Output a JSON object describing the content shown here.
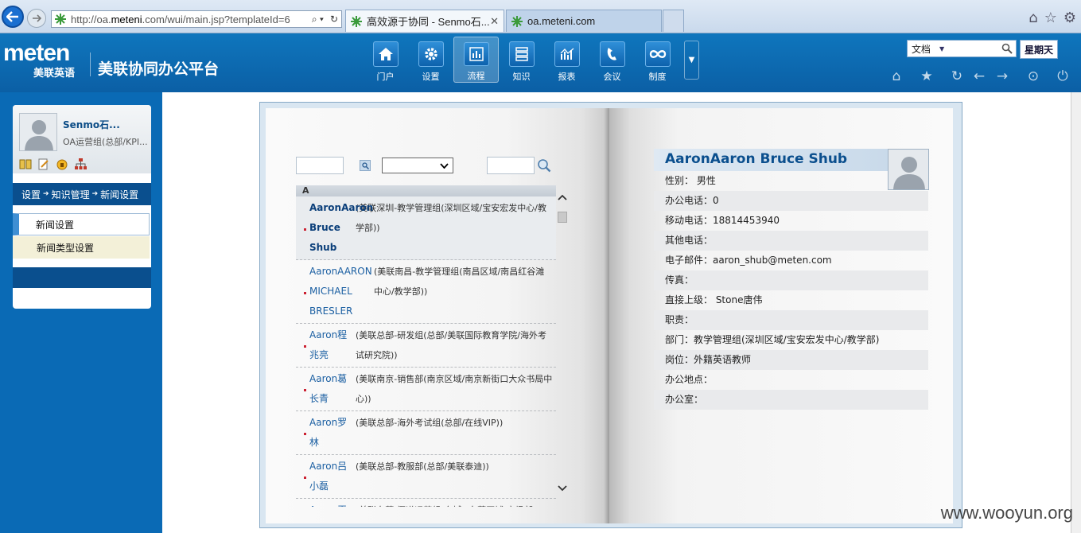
{
  "browser": {
    "address_url_prefix": "http://oa.",
    "address_url_host": "meteni",
    "address_url_rest": ".com/wui/main.jsp?templateId=6",
    "tabs": [
      {
        "title": "高效源于协同 - Senmo石..."
      },
      {
        "title": "oa.meteni.com"
      }
    ]
  },
  "app": {
    "logo_en": "meten",
    "logo_cn": "美联英语",
    "title": "美联协同办公平台",
    "modules": [
      {
        "label": "门户",
        "icon": "home-icon"
      },
      {
        "label": "设置",
        "icon": "gear-icon"
      },
      {
        "label": "流程",
        "icon": "workflow-chart-icon"
      },
      {
        "label": "知识",
        "icon": "knowledge-server-icon"
      },
      {
        "label": "报表",
        "icon": "report-chart-icon"
      },
      {
        "label": "会议",
        "icon": "phone-icon"
      },
      {
        "label": "制度",
        "icon": "infinity-icon"
      }
    ],
    "active_module": "流程",
    "search_scope": "文档",
    "weekday": "星期天"
  },
  "sidebar": {
    "user_name": "Senmo石...",
    "user_dept": "OA运营组(总部/KPI...",
    "breadcrumb": [
      "设置",
      "知识管理",
      "新闻设置"
    ],
    "menu": [
      {
        "label": "新闻设置"
      },
      {
        "label": "新闻类型设置"
      }
    ]
  },
  "directory": {
    "letter": "A",
    "entries": [
      {
        "name": "AaronAaron Bruce Shub",
        "dept": "(美联深圳-教学管理组(深圳区域/宝安宏发中心/教学部))"
      },
      {
        "name": "AaronAARON MICHAEL BRESLER",
        "dept": "(美联南昌-教学管理组(南昌区域/南昌红谷滩中心/教学部))"
      },
      {
        "name": "Aaron程兆亮",
        "dept": "(美联总部-研发组(总部/美联国际教育学院/海外考试研究院))"
      },
      {
        "name": "Aaron葛长青",
        "dept": "(美联南京-销售部(南京区域/南京新街口大众书局中心))"
      },
      {
        "name": "Aaron罗林",
        "dept": "(美联总部-海外考试组(总部/在线VIP))"
      },
      {
        "name": "Aaron吕小磊",
        "dept": "(美联总部-教服部(总部/美联泰迪))"
      },
      {
        "name": "Aaron王腾恩",
        "dept": "(美联东莞-渠道运营组(东城)(东莞区域/市场部))"
      }
    ]
  },
  "profile": {
    "name": "AaronAaron Bruce Shub",
    "fields": [
      "性别： 男性",
      "办公电话：0",
      "移动电话：18814453940",
      "其他电话：",
      "电子邮件：aaron_shub@meten.com",
      "传真：",
      "直接上级： Stone唐伟",
      "职责：",
      "部门：教学管理组(深圳区域/宝安宏发中心/教学部)",
      "岗位：外籍英语教师",
      "办公地点：",
      "办公室："
    ]
  },
  "watermark": "www.wooyun.org",
  "colors": {
    "header_blue": "#0f76bd",
    "side_blue": "#0a6ab5",
    "link_blue": "#1b5fa2"
  }
}
